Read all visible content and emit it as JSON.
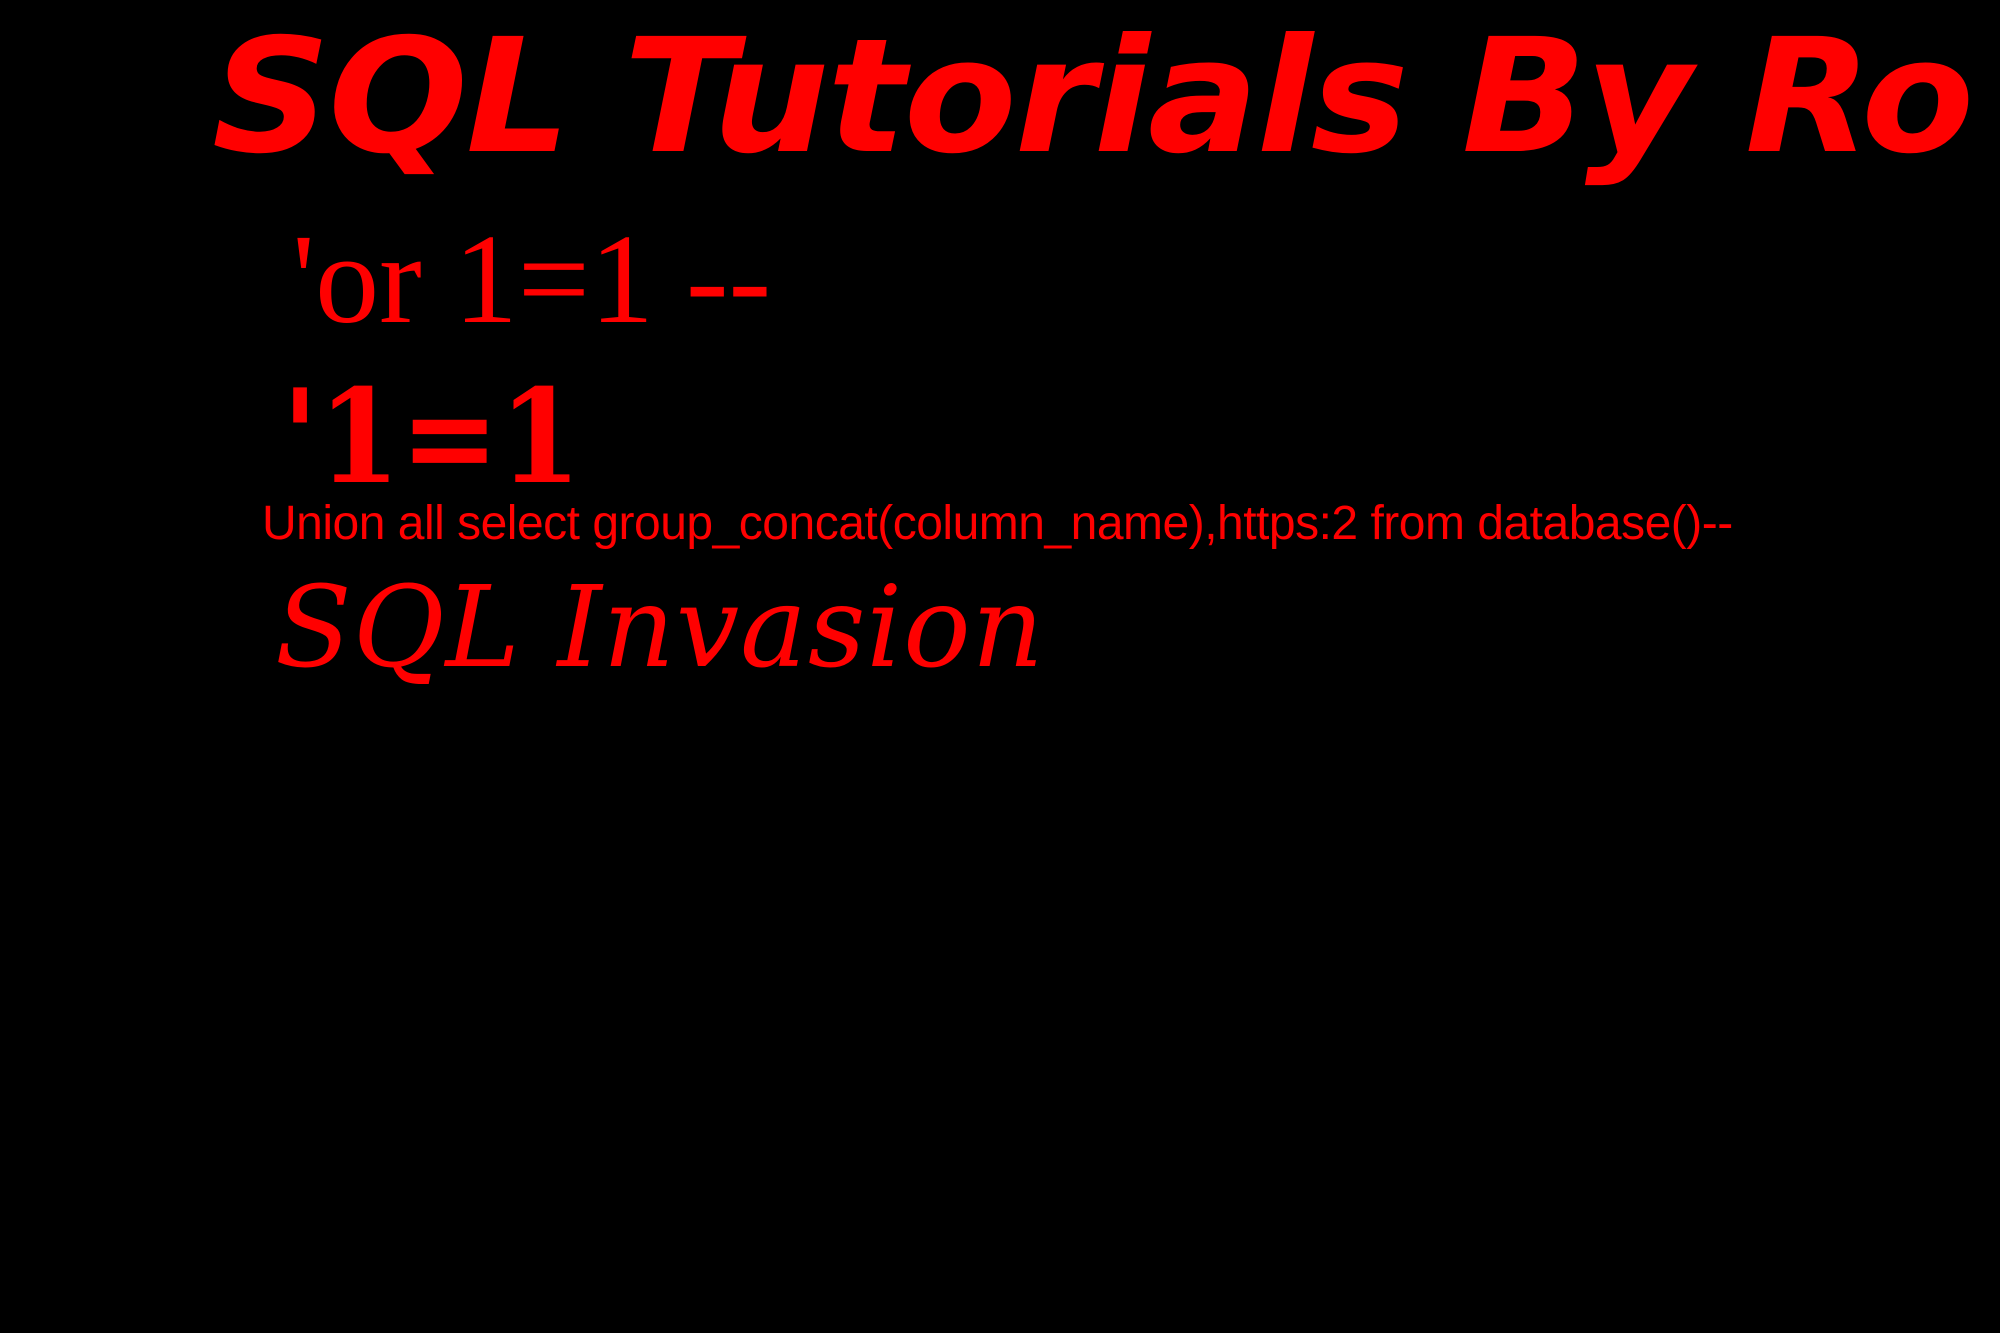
{
  "colors": {
    "background": "#000000",
    "text": "#ff0000"
  },
  "slide": {
    "title": "SQL Tutorials By Ro",
    "lines": [
      "'or 1=1 --",
      "'1=1",
      "Union all select group_concat(column_name),https:2 from database()--"
    ],
    "tagline": "SQL Invasion"
  }
}
